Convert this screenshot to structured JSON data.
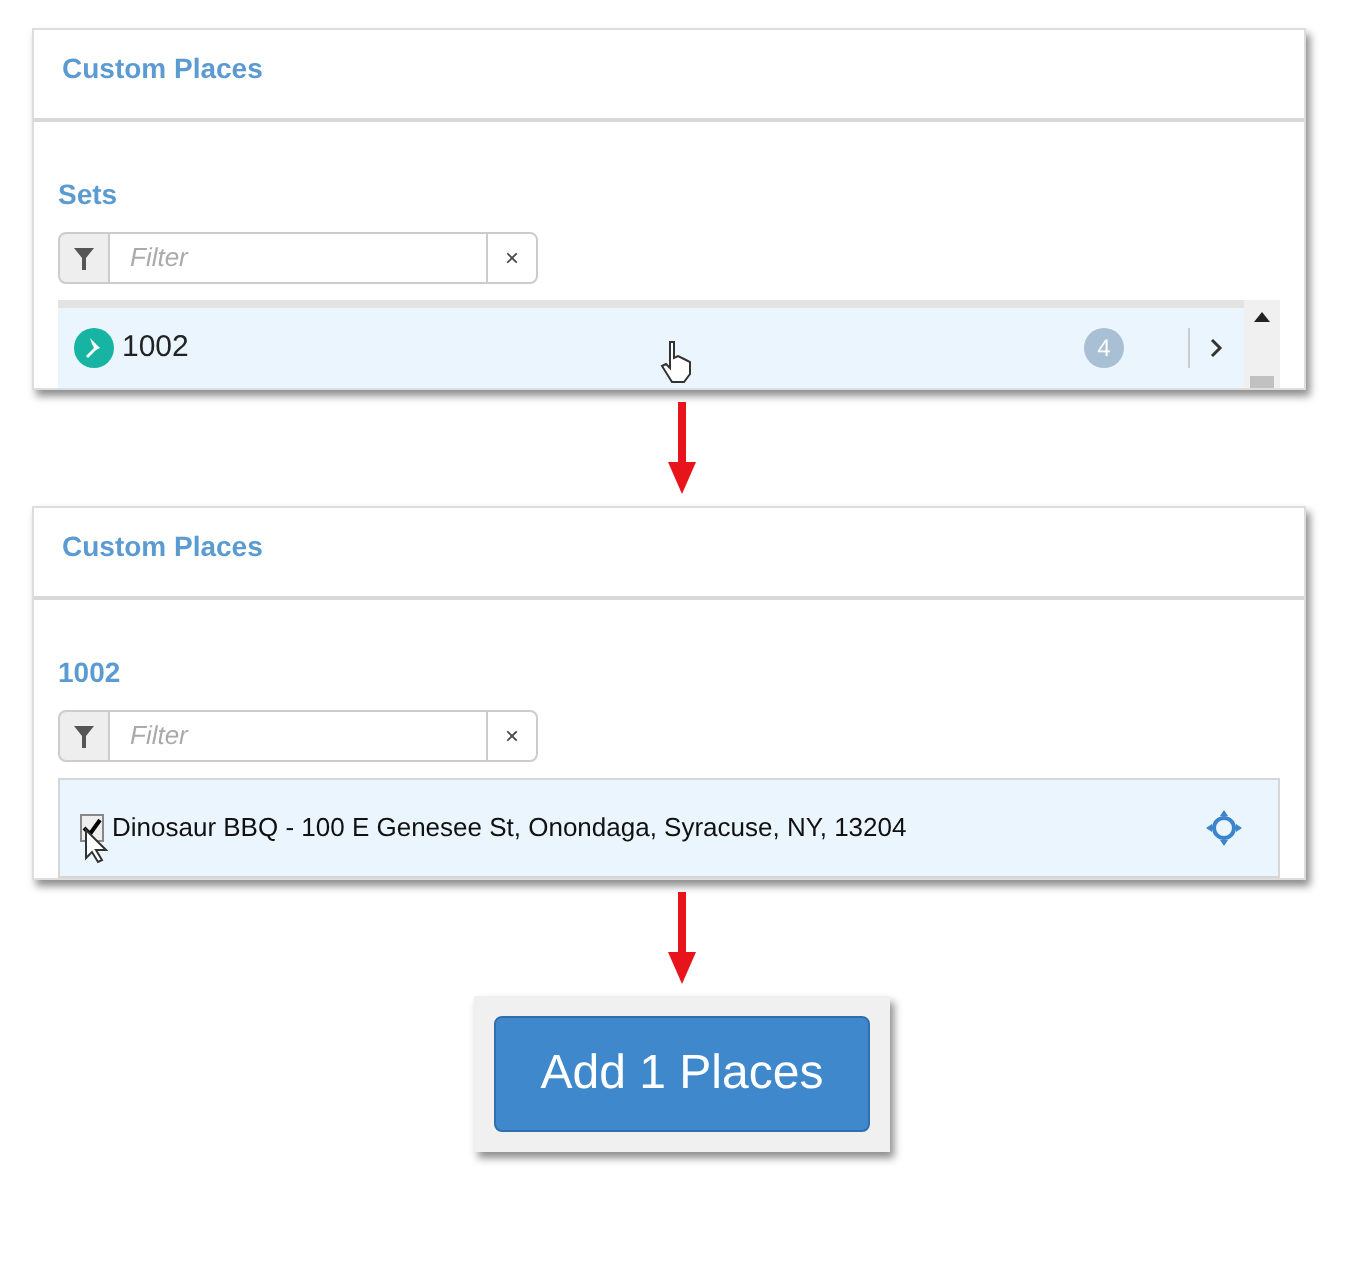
{
  "steps": [
    {
      "kind": "panel",
      "title": "Custom Places",
      "heading": "Sets",
      "filter": {
        "placeholder": "Filter",
        "clear": "×"
      },
      "scrollbar": true,
      "rows": [
        {
          "kind": "set",
          "label": "1002",
          "count": "4"
        }
      ]
    },
    {
      "kind": "panel",
      "title": "Custom Places",
      "heading": "1002",
      "filter": {
        "placeholder": "Filter",
        "clear": "×"
      },
      "scrollbar": false,
      "rows": [
        {
          "kind": "place",
          "checked": true,
          "label": "Dinosaur BBQ - 100 E Genesee St, Onondaga, Syracuse, NY, 13204"
        }
      ]
    },
    {
      "kind": "button",
      "label": "Add 1 Places"
    }
  ]
}
